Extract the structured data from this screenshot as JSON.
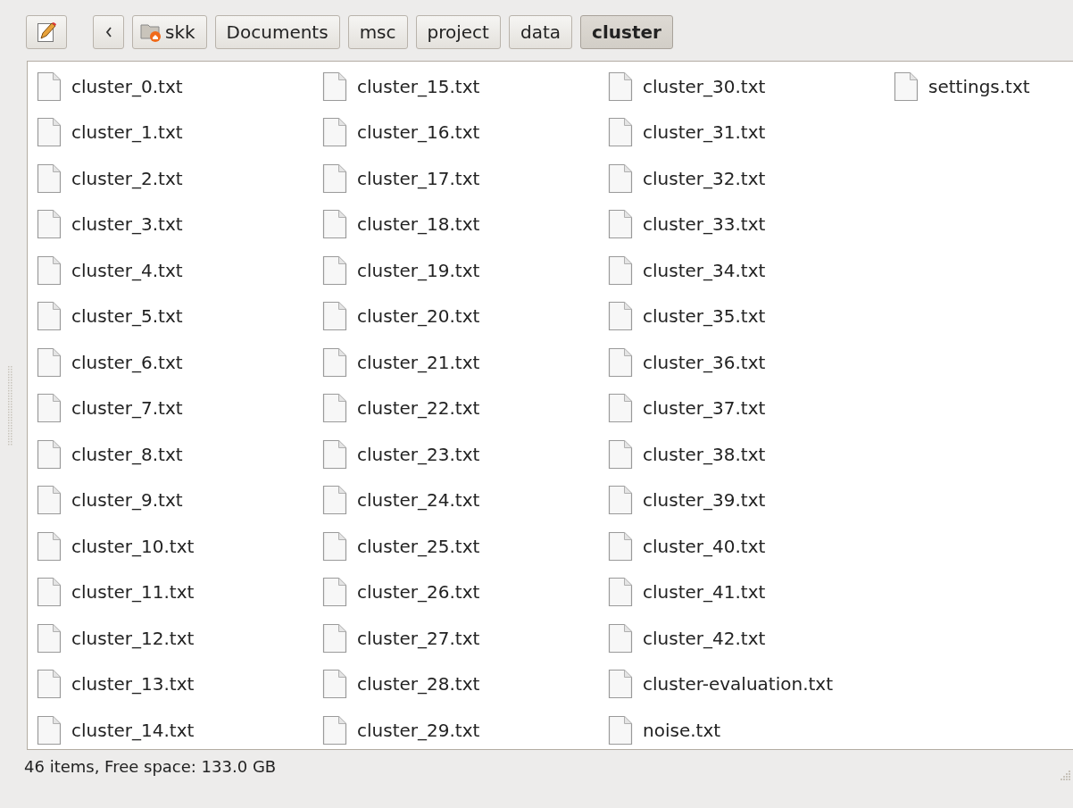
{
  "toolbar": {
    "path": [
      {
        "label": "skk",
        "kind": "home",
        "selected": false
      },
      {
        "label": "Documents",
        "kind": "folder",
        "selected": false
      },
      {
        "label": "msc",
        "kind": "folder",
        "selected": false
      },
      {
        "label": "project",
        "kind": "folder",
        "selected": false
      },
      {
        "label": "data",
        "kind": "folder",
        "selected": false
      },
      {
        "label": "cluster",
        "kind": "folder",
        "selected": true
      }
    ]
  },
  "files": [
    {
      "name": "cluster_0.txt"
    },
    {
      "name": "cluster_1.txt"
    },
    {
      "name": "cluster_2.txt"
    },
    {
      "name": "cluster_3.txt"
    },
    {
      "name": "cluster_4.txt"
    },
    {
      "name": "cluster_5.txt"
    },
    {
      "name": "cluster_6.txt"
    },
    {
      "name": "cluster_7.txt"
    },
    {
      "name": "cluster_8.txt"
    },
    {
      "name": "cluster_9.txt"
    },
    {
      "name": "cluster_10.txt"
    },
    {
      "name": "cluster_11.txt"
    },
    {
      "name": "cluster_12.txt"
    },
    {
      "name": "cluster_13.txt"
    },
    {
      "name": "cluster_14.txt"
    },
    {
      "name": "cluster_15.txt"
    },
    {
      "name": "cluster_16.txt"
    },
    {
      "name": "cluster_17.txt"
    },
    {
      "name": "cluster_18.txt"
    },
    {
      "name": "cluster_19.txt"
    },
    {
      "name": "cluster_20.txt"
    },
    {
      "name": "cluster_21.txt"
    },
    {
      "name": "cluster_22.txt"
    },
    {
      "name": "cluster_23.txt"
    },
    {
      "name": "cluster_24.txt"
    },
    {
      "name": "cluster_25.txt"
    },
    {
      "name": "cluster_26.txt"
    },
    {
      "name": "cluster_27.txt"
    },
    {
      "name": "cluster_28.txt"
    },
    {
      "name": "cluster_29.txt"
    },
    {
      "name": "cluster_30.txt"
    },
    {
      "name": "cluster_31.txt"
    },
    {
      "name": "cluster_32.txt"
    },
    {
      "name": "cluster_33.txt"
    },
    {
      "name": "cluster_34.txt"
    },
    {
      "name": "cluster_35.txt"
    },
    {
      "name": "cluster_36.txt"
    },
    {
      "name": "cluster_37.txt"
    },
    {
      "name": "cluster_38.txt"
    },
    {
      "name": "cluster_39.txt"
    },
    {
      "name": "cluster_40.txt"
    },
    {
      "name": "cluster_41.txt"
    },
    {
      "name": "cluster_42.txt"
    },
    {
      "name": "cluster-evaluation.txt"
    },
    {
      "name": "noise.txt"
    },
    {
      "name": "settings.txt"
    }
  ],
  "status_bar": {
    "text": "46 items, Free space: 133.0 GB"
  }
}
